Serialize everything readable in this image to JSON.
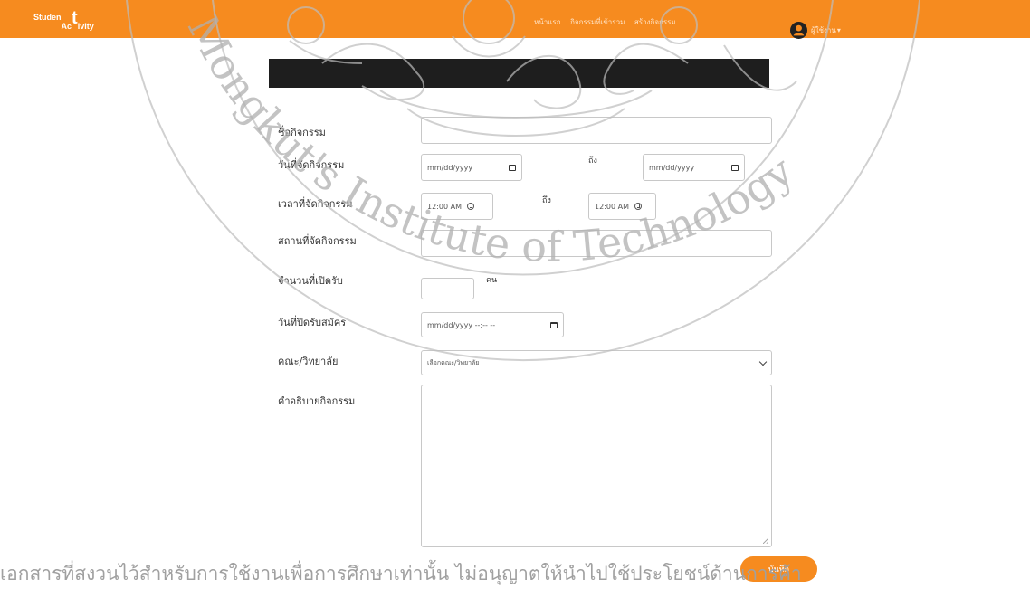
{
  "navbar": {
    "logo": {
      "part1": "Studen",
      "big": "t",
      "part2": "Ac",
      "part3": "ivity"
    },
    "links": [
      "หน้าแรก",
      "กิจกรรมที่เข้าร่วม",
      "สร้างกิจกรรม"
    ],
    "user_name": "ผู้ใช้งาน",
    "caret": "▾"
  },
  "form": {
    "name_label": "ชื่อกิจกรรม",
    "date_label": "วันที่จัดกิจกรรม",
    "date_start_placeholder": "mm/dd/yyyy",
    "date_to": "ถึง",
    "date_end_placeholder": "mm/dd/yyyy",
    "time_label": "เวลาที่จัดกิจกรรม",
    "time_start_value": "12:00 AM",
    "time_to": "ถึง",
    "time_end_value": "12:00 AM",
    "place_label": "สถานที่จัดกิจกรรม",
    "seats_label": "จำนวนที่เปิดรับ",
    "seats_unit": "คน",
    "close_label": "วันที่ปิดรับสมัคร",
    "close_placeholder": "mm/dd/yyyy --:-- --",
    "faculty_label": "คณะ/วิทยาลัย",
    "faculty_selected": "เลือกคณะ/วิทยาลัย",
    "desc_label": "คำอธิบายกิจกรรม",
    "save_label": "บันทึก"
  },
  "watermark": {
    "text_top": "Mongkut's Institute of Technology",
    "footer": "เอกสารที่สงวนไว้สำหรับการใช้งานเพื่อการศึกษาเท่านั้น ไม่อนุญาตให้นำไปใช้ประโยชน์ด้านการค้า"
  },
  "colors": {
    "accent": "#f68b1f",
    "banner": "#1e1e1e"
  }
}
